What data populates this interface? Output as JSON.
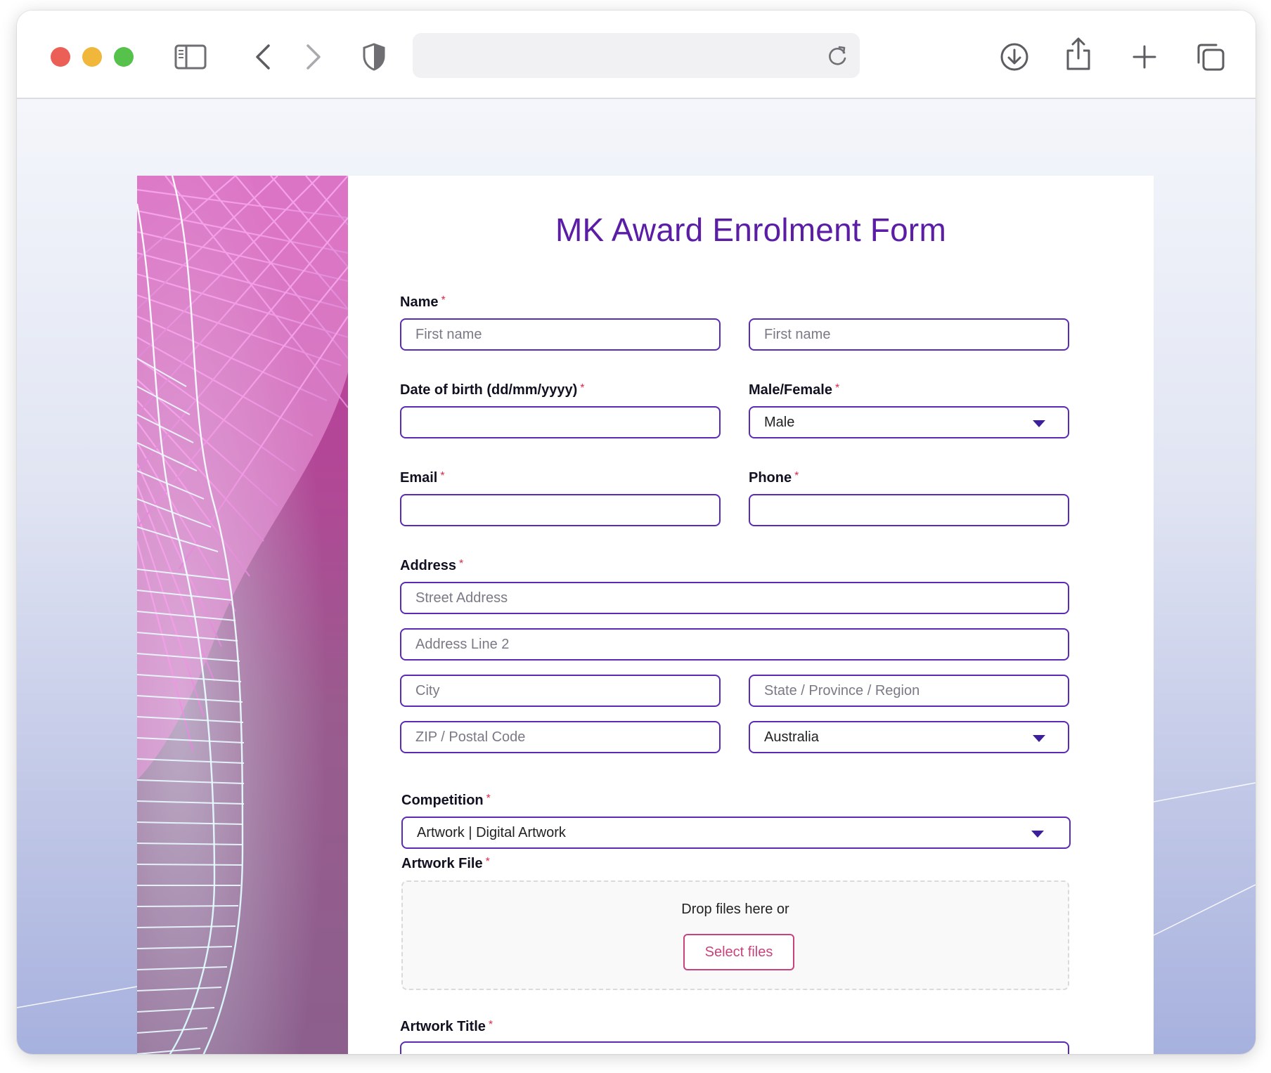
{
  "browser": {
    "icons": {
      "sidebar": "sidebar-icon",
      "back": "chevron-left-icon",
      "forward": "chevron-right-icon",
      "privacy": "shield-icon",
      "reload": "reload-icon",
      "download": "download-icon",
      "share": "share-icon",
      "new_tab": "plus-icon",
      "tabs": "tabs-overview-icon"
    }
  },
  "form": {
    "title": "MK Award Enrolment Form",
    "required_mark": "*",
    "name": {
      "label": "Name",
      "first_placeholder": "First name",
      "second_placeholder": "First name"
    },
    "dob": {
      "label": "Date of birth (dd/mm/yyyy)",
      "value": ""
    },
    "gender": {
      "label": "Male/Female",
      "selected": "Male"
    },
    "email": {
      "label": "Email",
      "value": ""
    },
    "phone": {
      "label": "Phone",
      "value": ""
    },
    "address": {
      "label": "Address",
      "street_placeholder": "Street Address",
      "line2_placeholder": "Address Line 2",
      "city_placeholder": "City",
      "state_placeholder": "State / Province / Region",
      "zip_placeholder": "ZIP / Postal Code",
      "country_selected": "Australia"
    },
    "competition": {
      "label": "Competition",
      "selected": "Artwork | Digital Artwork"
    },
    "artwork_file": {
      "label": "Artwork File",
      "drop_text": "Drop files here or",
      "button_label": "Select files"
    },
    "artwork_title": {
      "label": "Artwork Title"
    }
  },
  "colors": {
    "title": "#5b1ca6",
    "input_border": "#5b2bb5",
    "required": "#e0294a",
    "select_files": "#c8437c"
  }
}
